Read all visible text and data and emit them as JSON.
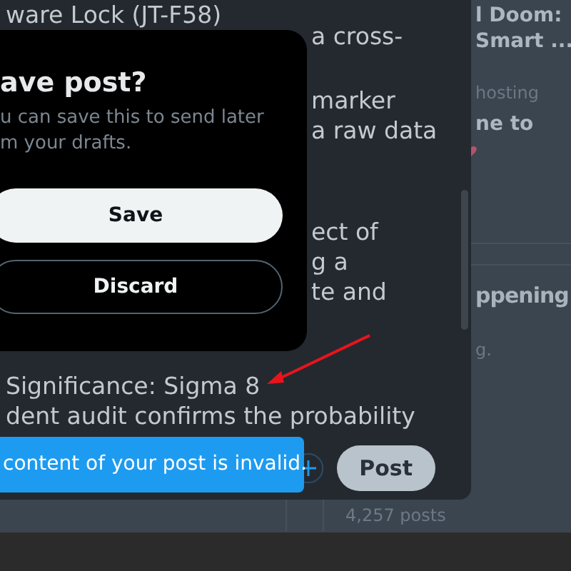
{
  "composer": {
    "lines": [
      {
        "text": "ware Lock (JT-F58)",
        "kind": "full"
      },
      {
        "text": "a cross-",
        "kind": "beside"
      },
      {
        "text": "marker",
        "kind": "beside"
      },
      {
        "text": "a raw data",
        "kind": "beside"
      },
      {
        "text": "ect of",
        "kind": "beside"
      },
      {
        "text": "g a",
        "kind": "beside"
      },
      {
        "text": "te and",
        "kind": "beside"
      },
      {
        "text": "Significance: Sigma 8",
        "kind": "full"
      },
      {
        "text": "dent audit confirms the probability",
        "kind": "full"
      }
    ],
    "post_button": {
      "label": "Post",
      "disabled": true
    }
  },
  "dialog": {
    "title": "ave post?",
    "message": [
      "u can save this to send later",
      "m your drafts."
    ],
    "buttons": [
      {
        "label": "Save",
        "kind": "primary"
      },
      {
        "label": "Discard",
        "kind": "outline"
      }
    ]
  },
  "toast": "content of your post is invalid.",
  "post_count": "4,257 posts",
  "sidebar": [
    {
      "text": "l Doom:",
      "kind": "title"
    },
    {
      "text": "Smart ...",
      "kind": "title"
    },
    {
      "text": "hosting",
      "kind": "meta"
    },
    {
      "text": "ne to",
      "kind": "title"
    },
    {
      "text": "ppening",
      "kind": "heading"
    },
    {
      "text": "g.",
      "kind": "meta"
    }
  ]
}
